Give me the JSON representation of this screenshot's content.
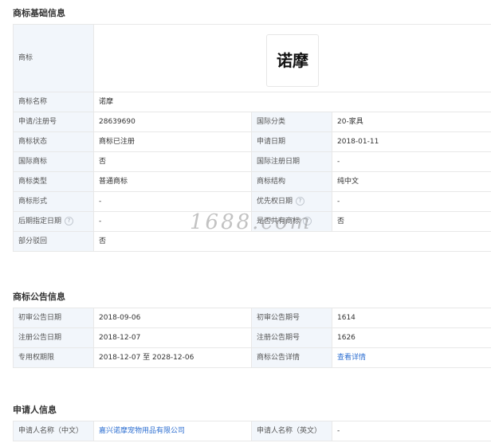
{
  "basic": {
    "title": "商标基础信息",
    "logo_label": "商标",
    "logo_text": "诺摩",
    "name_label": "商标名称",
    "name_value": "诺摩",
    "rows": [
      {
        "l1": "申请/注册号",
        "v1": "28639690",
        "l2": "国际分类",
        "v2": "20-家具"
      },
      {
        "l1": "商标状态",
        "v1": "商标已注册",
        "l2": "申请日期",
        "v2": "2018-01-11"
      },
      {
        "l1": "国际商标",
        "v1": "否",
        "l2": "国际注册日期",
        "v2": "-"
      },
      {
        "l1": "商标类型",
        "v1": "普通商标",
        "l2": "商标结构",
        "v2": "纯中文"
      },
      {
        "l1": "商标形式",
        "v1": "-",
        "l2": "优先权日期",
        "v2": "-"
      },
      {
        "l1": "后期指定日期",
        "v1": "-",
        "l2": "是否共有商标",
        "v2": "否"
      }
    ],
    "partial_label": "部分驳回",
    "partial_value": "否"
  },
  "notice": {
    "title": "商标公告信息",
    "rows": [
      {
        "l1": "初审公告日期",
        "v1": "2018-09-06",
        "l2": "初审公告期号",
        "v2": "1614"
      },
      {
        "l1": "注册公告日期",
        "v1": "2018-12-07",
        "l2": "注册公告期号",
        "v2": "1626"
      },
      {
        "l1": "专用权期限",
        "v1": "2018-12-07 至 2028-12-06",
        "l2": "商标公告详情",
        "v2": "查看详情"
      }
    ]
  },
  "applicant": {
    "title": "申请人信息",
    "rows": [
      {
        "l1": "申请人名称（中文）",
        "v1": "嘉兴诺摩宠物用品有限公司",
        "l2": "申请人名称（英文）",
        "v2": "-"
      }
    ]
  },
  "watermark": "1688.com",
  "colors": {
    "label_bg": "#f2f6fb",
    "border": "#e8e8e8",
    "link": "#2e6fd1"
  },
  "icons": {
    "help": "question-circle-icon"
  }
}
